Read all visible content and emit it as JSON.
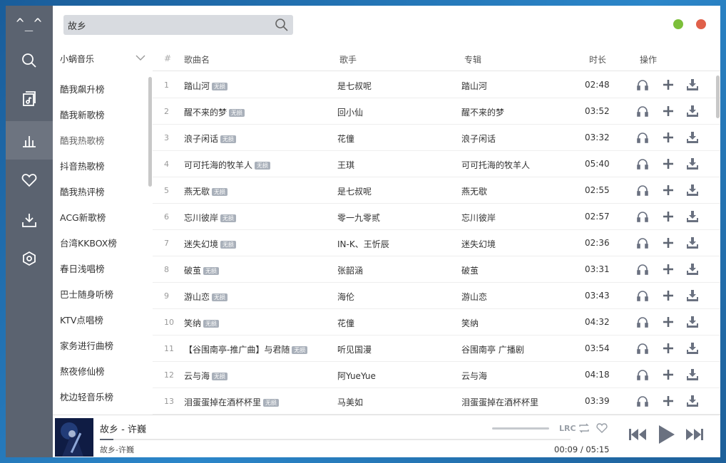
{
  "nav": {
    "logo": "^_^"
  },
  "search": {
    "value": "故乡",
    "placeholder": ""
  },
  "sidebar": {
    "title": "小蜗音乐",
    "items": [
      "酷我飙升榜",
      "酷我新歌榜",
      "酷我热歌榜",
      "抖音热歌榜",
      "酷我热评榜",
      "ACG新歌榜",
      "台湾KKBOX榜",
      "春日浅唱榜",
      "巴士随身听榜",
      "KTV点唱榜",
      "家务进行曲榜",
      "熬夜修仙榜",
      "枕边轻音乐榜"
    ],
    "active_index": 2
  },
  "table": {
    "headers": {
      "idx": "#",
      "name": "歌曲名",
      "artist": "歌手",
      "album": "专辑",
      "duration": "时长",
      "ops": "操作"
    },
    "tag_label": "无损",
    "rows": [
      {
        "idx": "1",
        "name": "踏山河",
        "artist": "是七叔呢",
        "album": "踏山河",
        "duration": "02:48"
      },
      {
        "idx": "2",
        "name": "醒不来的梦",
        "artist": "回小仙",
        "album": "醒不来的梦",
        "duration": "03:52"
      },
      {
        "idx": "3",
        "name": "浪子闲话",
        "artist": "花僮",
        "album": "浪子闲话",
        "duration": "03:32"
      },
      {
        "idx": "4",
        "name": "可可托海的牧羊人",
        "artist": "王琪",
        "album": "可可托海的牧羊人",
        "duration": "05:40"
      },
      {
        "idx": "5",
        "name": "燕无歇",
        "artist": "是七叔呢",
        "album": "燕无歇",
        "duration": "02:55"
      },
      {
        "idx": "6",
        "name": "忘川彼岸",
        "artist": "零一九零贰",
        "album": "忘川彼岸",
        "duration": "02:57"
      },
      {
        "idx": "7",
        "name": "迷失幻境",
        "artist": "IN-K、王忻辰",
        "album": "迷失幻境",
        "duration": "02:36"
      },
      {
        "idx": "8",
        "name": "破茧",
        "artist": "张韶涵",
        "album": "破茧",
        "duration": "03:31"
      },
      {
        "idx": "9",
        "name": "游山恋",
        "artist": "海伦",
        "album": "游山恋",
        "duration": "03:43"
      },
      {
        "idx": "10",
        "name": "笑纳",
        "artist": "花僮",
        "album": "笑纳",
        "duration": "04:32"
      },
      {
        "idx": "11",
        "name": "【谷围南亭-推广曲】与君随",
        "artist": "听见国漫",
        "album": "谷围南亭 广播剧",
        "duration": "03:54"
      },
      {
        "idx": "12",
        "name": "云与海",
        "artist": "阿YueYue",
        "album": "云与海",
        "duration": "04:18"
      },
      {
        "idx": "13",
        "name": "泪蛋蛋掉在酒杯杯里",
        "artist": "马美如",
        "album": "泪蛋蛋掉在酒杯杯里",
        "duration": "03:39"
      }
    ]
  },
  "player": {
    "title": "故乡 - 许巍",
    "subtitle": "故乡-许巍",
    "current_time": "00:09",
    "separator": "/",
    "total_time": "05:15",
    "progress_fraction": 0.029,
    "lrc_label": "LRC"
  },
  "colors": {
    "nav_bg": "#5b6370",
    "nav_active": "#6d7480",
    "green_dot": "#7cbf3a",
    "red_dot": "#e0604a"
  }
}
